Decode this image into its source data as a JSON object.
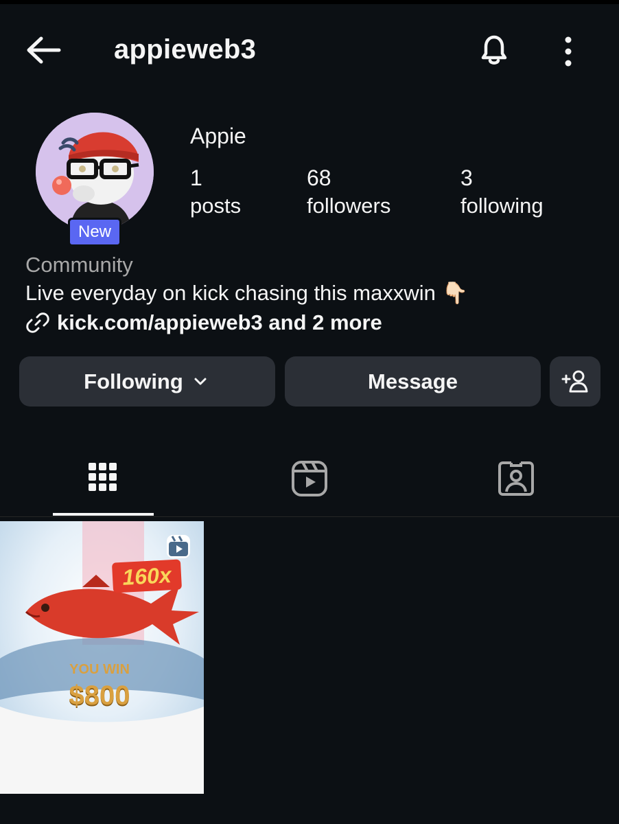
{
  "header": {
    "username": "appieweb3"
  },
  "profile": {
    "display_name": "Appie",
    "badge": "New",
    "category": "Community",
    "bio": "Live everyday on kick chasing this maxxwin 👇🏻",
    "link": "kick.com/appieweb3 and 2 more",
    "stats": [
      {
        "value": "1",
        "label": "posts"
      },
      {
        "value": "68",
        "label": "followers"
      },
      {
        "value": "3",
        "label": "following"
      }
    ]
  },
  "actions": {
    "following_label": "Following",
    "message_label": "Message"
  },
  "tabs": [
    {
      "icon": "grid-icon",
      "active": true
    },
    {
      "icon": "reels-icon",
      "active": false
    },
    {
      "icon": "tagged-icon",
      "active": false
    }
  ],
  "posts": [
    {
      "type": "reel",
      "multiplier": "160x",
      "caption_top": "YOU WIN",
      "caption_amount": "$800"
    }
  ],
  "colors": {
    "background": "#0c1014",
    "button": "#2b2f36",
    "badge": "#5a67f2",
    "secondary_text": "#a8a8a8"
  }
}
